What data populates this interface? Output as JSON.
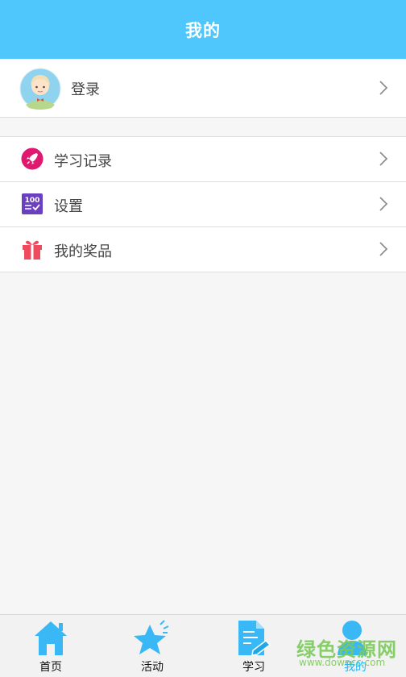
{
  "header": {
    "title": "我的"
  },
  "login": {
    "label": "登录",
    "icon": "avatar-icon"
  },
  "menu": {
    "items": [
      {
        "label": "学习记录",
        "icon": "rocket-icon",
        "color": "#e0186f"
      },
      {
        "label": "设置",
        "icon": "score-100-icon",
        "color": "#6a3fc0"
      },
      {
        "label": "我的奖品",
        "icon": "gift-icon",
        "color": "#f04a5f"
      }
    ]
  },
  "tabbar": {
    "tabs": [
      {
        "label": "首页",
        "icon": "home-icon"
      },
      {
        "label": "活动",
        "icon": "star-icon"
      },
      {
        "label": "学习",
        "icon": "document-pencil-icon"
      },
      {
        "label": "我的",
        "icon": "person-icon",
        "active": true
      }
    ]
  },
  "watermark": {
    "title": "绿色资源网",
    "site": "www.downcc.com"
  },
  "colors": {
    "accent": "#4fc6fc",
    "tab_icon": "#39b8f5"
  }
}
